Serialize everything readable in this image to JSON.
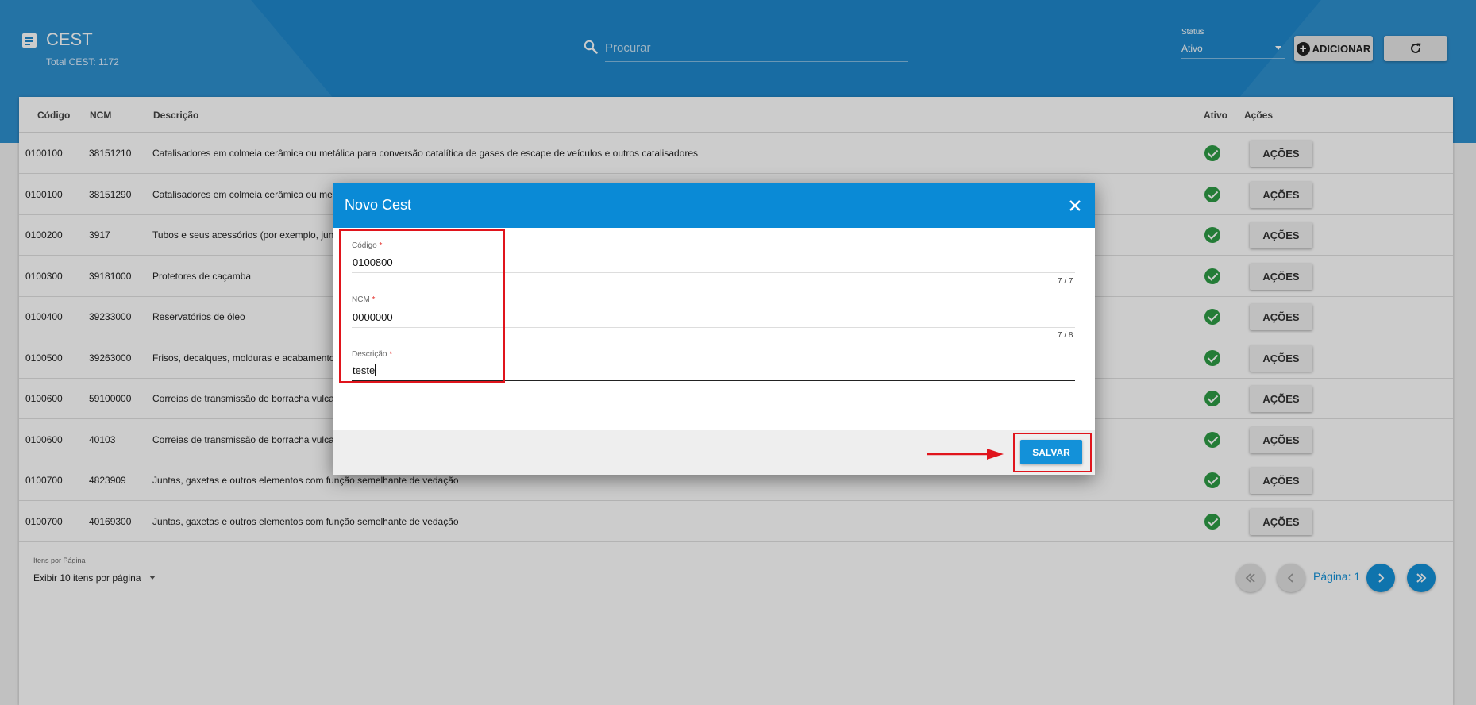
{
  "header": {
    "title": "CEST",
    "subtitle": "Total CEST: 1172",
    "search_placeholder": "Procurar",
    "status_label": "Status",
    "status_value": "Ativo",
    "add_label": "ADICIONAR"
  },
  "table": {
    "columns": {
      "codigo": "Código",
      "ncm": "NCM",
      "descricao": "Descrição",
      "ativo": "Ativo",
      "acoes": "Ações"
    },
    "rows": [
      {
        "codigo": "0100100",
        "ncm": "38151210",
        "descricao": "Catalisadores em colmeia cerâmica ou metálica para conversão catalítica de gases de escape de veículos e outros catalisadores",
        "ativo": true,
        "acao": "AÇÕES"
      },
      {
        "codigo": "0100100",
        "ncm": "38151290",
        "descricao": "Catalisadores em colmeia cerâmica ou metá",
        "ativo": true,
        "acao": "AÇÕES"
      },
      {
        "codigo": "0100200",
        "ncm": "3917",
        "descricao": "Tubos e seus acessórios (por exemplo, junta",
        "ativo": true,
        "acao": "AÇÕES"
      },
      {
        "codigo": "0100300",
        "ncm": "39181000",
        "descricao": "Protetores de caçamba",
        "ativo": true,
        "acao": "AÇÕES"
      },
      {
        "codigo": "0100400",
        "ncm": "39233000",
        "descricao": "Reservatórios de óleo",
        "ativo": true,
        "acao": "AÇÕES"
      },
      {
        "codigo": "0100500",
        "ncm": "39263000",
        "descricao": "Frisos, decalques, molduras e acabamentos",
        "ativo": true,
        "acao": "AÇÕES"
      },
      {
        "codigo": "0100600",
        "ncm": "59100000",
        "descricao": "Correias de transmissão de borracha vulcani",
        "ativo": true,
        "acao": "AÇÕES"
      },
      {
        "codigo": "0100600",
        "ncm": "40103",
        "descricao": "Correias de transmissão de borracha vulcani",
        "ativo": true,
        "acao": "AÇÕES"
      },
      {
        "codigo": "0100700",
        "ncm": "4823909",
        "descricao": "Juntas, gaxetas e outros elementos com função semelhante de vedação",
        "ativo": true,
        "acao": "AÇÕES"
      },
      {
        "codigo": "0100700",
        "ncm": "40169300",
        "descricao": "Juntas, gaxetas e outros elementos com função semelhante de vedação",
        "ativo": true,
        "acao": "AÇÕES"
      }
    ]
  },
  "pagination": {
    "per_page_label": "Itens por Página",
    "per_page_value": "Exibir 10 itens por página",
    "page_text": "Página: 1"
  },
  "modal": {
    "title": "Novo Cest",
    "fields": [
      {
        "label": "Código",
        "value": "0100800",
        "counter": "7 / 7"
      },
      {
        "label": "NCM",
        "value": "0000000",
        "counter": "7 / 8"
      },
      {
        "label": "Descrição",
        "value": "teste",
        "counter": ""
      }
    ],
    "save_label": "SALVAR"
  },
  "colors": {
    "header_bg": "#1f88cc",
    "modal_header": "#0a8ad6",
    "primary_button": "#1391d9",
    "active_check": "#2e9b45",
    "annotation": "#e0141c"
  },
  "icons": {
    "title": "list-document-icon",
    "search": "search-icon",
    "add": "plus-circle-icon",
    "refresh": "refresh-icon",
    "active": "check-circle-icon",
    "close": "close-icon"
  }
}
